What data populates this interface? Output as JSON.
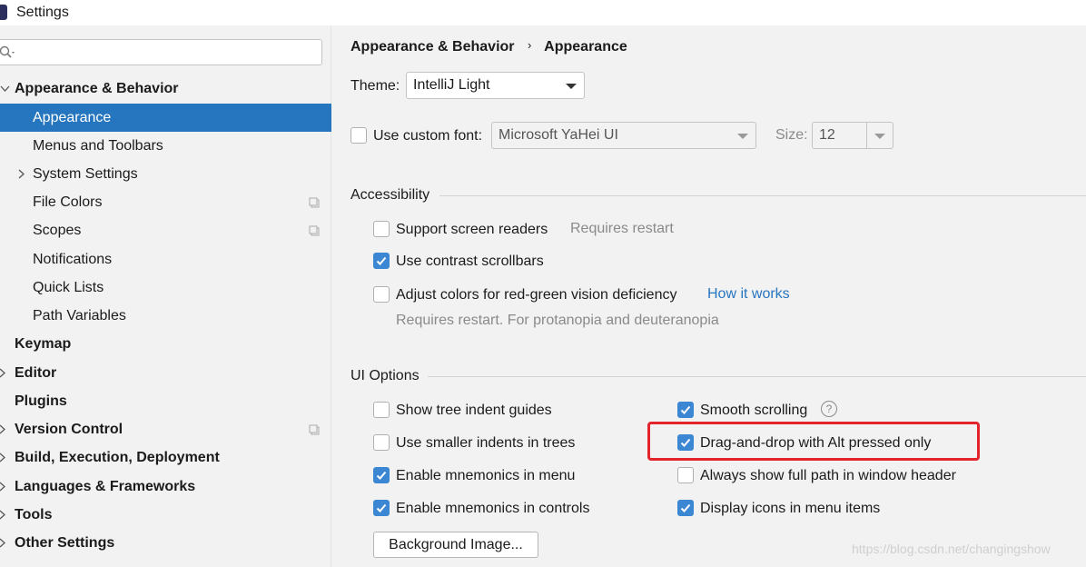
{
  "window": {
    "title": "Settings"
  },
  "sidebar": {
    "search_placeholder": "",
    "items": [
      {
        "label": "Appearance & Behavior",
        "bold": true,
        "expanded": true
      },
      {
        "label": "Appearance",
        "selected": true
      },
      {
        "label": "Menus and Toolbars"
      },
      {
        "label": "System Settings"
      },
      {
        "label": "File Colors"
      },
      {
        "label": "Scopes"
      },
      {
        "label": "Notifications"
      },
      {
        "label": "Quick Lists"
      },
      {
        "label": "Path Variables"
      },
      {
        "label": "Keymap",
        "bold": true
      },
      {
        "label": "Editor",
        "bold": true
      },
      {
        "label": "Plugins",
        "bold": true
      },
      {
        "label": "Version Control",
        "bold": true
      },
      {
        "label": "Build, Execution, Deployment",
        "bold": true
      },
      {
        "label": "Languages & Frameworks",
        "bold": true
      },
      {
        "label": "Tools",
        "bold": true
      },
      {
        "label": "Other Settings",
        "bold": true
      }
    ]
  },
  "main": {
    "breadcrumb": {
      "parent": "Appearance & Behavior",
      "separator": "›",
      "current": "Appearance"
    },
    "theme": {
      "label": "Theme:",
      "value": "IntelliJ Light"
    },
    "custom_font": {
      "label": "Use custom font:",
      "checked": false,
      "font": "Microsoft YaHei UI",
      "size_label": "Size:",
      "size": "12"
    },
    "accessibility": {
      "title": "Accessibility",
      "screen_readers": {
        "label": "Support screen readers",
        "checked": false,
        "note": "Requires restart"
      },
      "contrast_scrollbars": {
        "label": "Use contrast scrollbars",
        "checked": true
      },
      "red_green": {
        "label": "Adjust colors for red-green vision deficiency",
        "checked": false,
        "link": "How it works",
        "note": "Requires restart. For protanopia and deuteranopia"
      }
    },
    "ui_options": {
      "title": "UI Options",
      "tree_indent": {
        "label": "Show tree indent guides",
        "checked": false
      },
      "smaller_indents": {
        "label": "Use smaller indents in trees",
        "checked": false
      },
      "mnemonics_menu": {
        "label": "Enable mnemonics in menu",
        "checked": true
      },
      "mnemonics_controls": {
        "label": "Enable mnemonics in controls",
        "checked": true
      },
      "smooth_scrolling": {
        "label": "Smooth scrolling",
        "checked": true,
        "help": "?"
      },
      "drag_drop_alt": {
        "label": "Drag-and-drop with Alt pressed only",
        "checked": true
      },
      "full_path": {
        "label": "Always show full path in window header",
        "checked": false
      },
      "menu_icons": {
        "label": "Display icons in menu items",
        "checked": true
      },
      "background_image_button": "Background Image..."
    }
  },
  "watermark": "https://blog.csdn.net/changingshow",
  "colors": {
    "accent": "#2675bf",
    "checkbox": "#3b87d4",
    "highlight": "#e4242d"
  }
}
